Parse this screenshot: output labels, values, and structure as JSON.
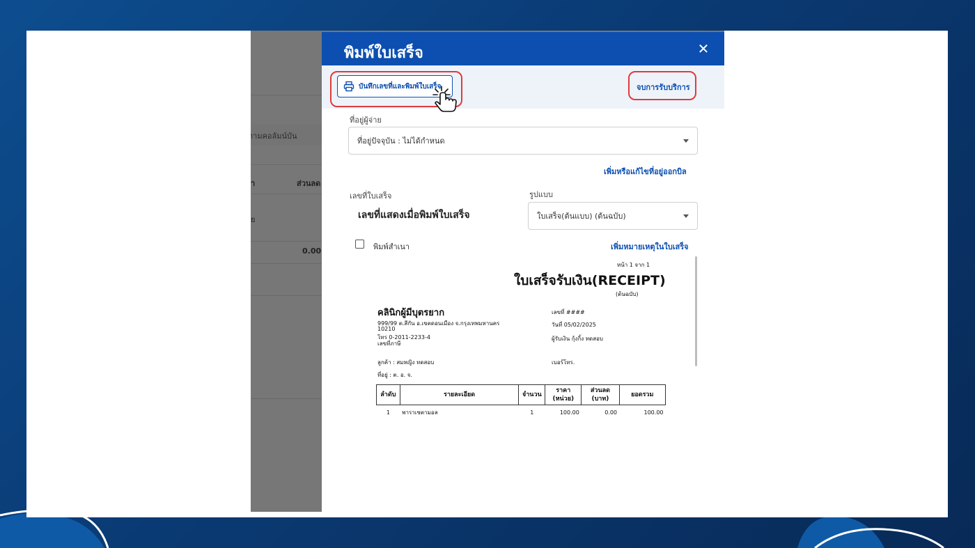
{
  "background_app": {
    "text_1": "ตามคอลัมน์บัน",
    "col_a": "า",
    "col_discount": "ส่วนลด",
    "text_2": "ย",
    "value": "0.00"
  },
  "modal": {
    "title": "พิมพ์ใบเสร็จ",
    "close_symbol": "✕",
    "save_print_label": "บันทึกเลขที่และพิมพ์ใบเสร็จ",
    "end_service_label": "จบการรับบริการ",
    "payer_address_label": "ที่อยู่ผู้จ่าย",
    "current_address_value": "ที่อยู่ปัจจุบัน : ไม่ได้กำหนด",
    "edit_billing_address_link": "เพิ่มหรือแก้ไขที่อยู่ออกบิล",
    "receipt_number_label": "เลขที่ใบเสร็จ",
    "receipt_number_value": "เลขที่แสดงเมื่อพิมพ์ใบเสร็จ",
    "format_label": "รูปแบบ",
    "format_value": "ใบเสร็จ(ต้นแบบ) (ต้นฉบับ)",
    "print_copy_label": "พิมพ์สำเนา",
    "add_note_link": "เพิ่มหมายเหตุในใบเสร็จ"
  },
  "receipt": {
    "page": "หน้า 1 จาก 1",
    "title": "ใบเสร็จรับเงิน(RECEIPT)",
    "subtitle": "(ต้นฉบับ)",
    "clinic_name": "คลินิกผู้มีบุตรยาก",
    "address_line1": "999/99  ต.สีกัน อ.เขตดอนเมือง จ.กรุงเทพมหานคร",
    "address_line2": "10210",
    "phone": "โทร 0-2011-2233-4",
    "tax_id": "เลขที่ภาษี",
    "no_label": "เลขที่  ####",
    "date_label": "วันที่   05/02/2025",
    "receiver_label": "ผู้รับเงิน  กุ้งกิ้ง ทดสอบ",
    "customer_label": "ลูกค้า :  สมหญิง ทดสอบ",
    "phone_no_label": "เบอร์โทร.",
    "address_label": "ที่อยู่ :     ต. อ. จ.",
    "table_headers": [
      "ลำดับ",
      "รายละเอียด",
      "จำนวน",
      "ราคา\n(หน่วย)",
      "ส่วนลด\n(บาท)",
      "ยอดรวม"
    ],
    "items": [
      {
        "no": "1",
        "detail": "พาราเซตามอล",
        "qty": "1",
        "price": "100.00",
        "discount": "0.00",
        "total": "100.00"
      }
    ]
  },
  "colors": {
    "primary": "#0c4fb0",
    "highlight": "#e03a3a",
    "backdrop": "#777777",
    "page_bg": "#0a3a73"
  }
}
